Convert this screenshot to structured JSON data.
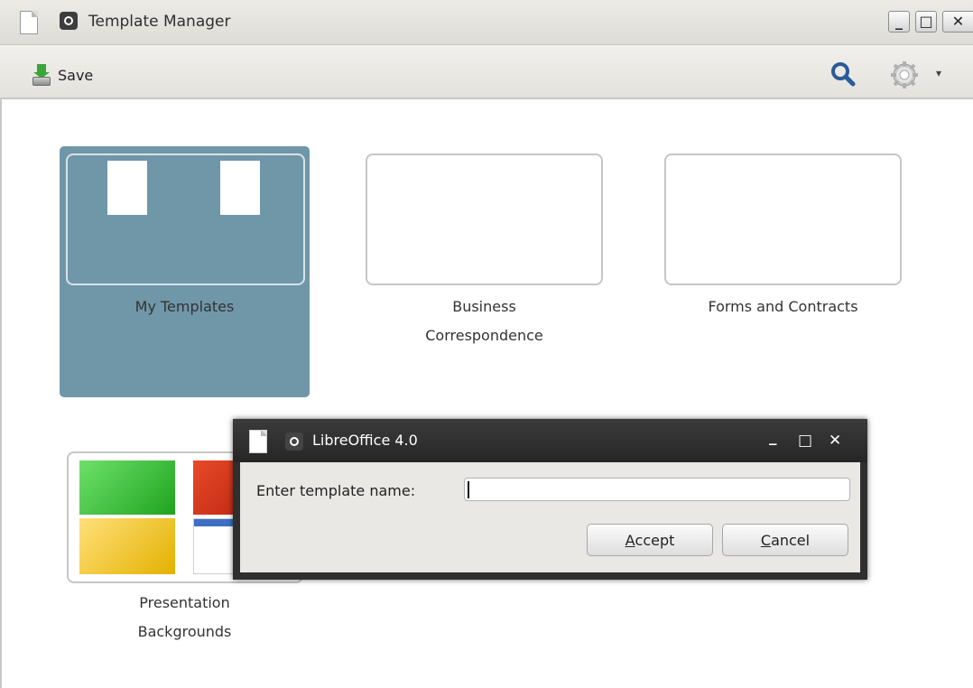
{
  "window": {
    "title": "Template Manager",
    "controls": {
      "minimize": "_",
      "maximize": "□",
      "close": "✕"
    }
  },
  "toolbar": {
    "save_label": "Save",
    "search_icon": "search-icon",
    "settings_icon": "gear-icon",
    "dropdown_arrow": "▾"
  },
  "folders": [
    {
      "name": "My Templates",
      "selected": true
    },
    {
      "name_line1": "Business",
      "name_line2": "Correspondence",
      "selected": false
    },
    {
      "name": "Forms and Contracts",
      "selected": false
    },
    {
      "name_line1": "Presentation",
      "name_line2": "Backgrounds",
      "selected": false
    }
  ],
  "dialog": {
    "title": "LibreOffice 4.0",
    "controls": {
      "minimize": "_",
      "maximize": "□",
      "close": "✕"
    },
    "label": "Enter template name:",
    "input_value": "",
    "accept": {
      "mnemonic": "A",
      "rest": "ccept"
    },
    "cancel": {
      "mnemonic": "C",
      "rest": "ancel"
    }
  },
  "colors": {
    "selection": "#6f97a8",
    "search_blue": "#2c5a9a",
    "dialog_frame": "#2f2f2f"
  }
}
